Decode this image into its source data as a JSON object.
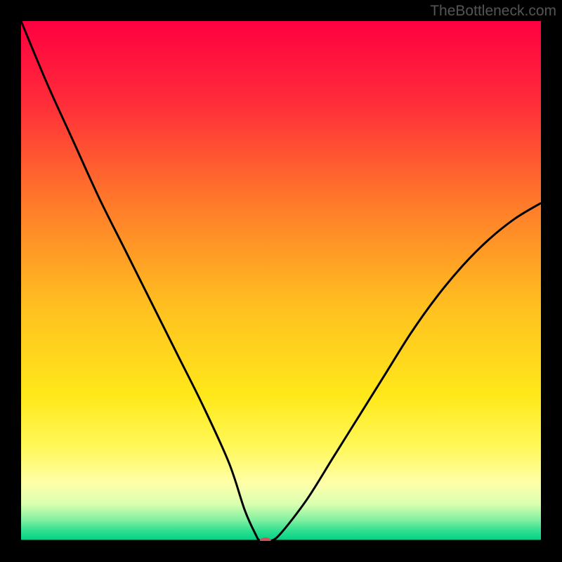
{
  "watermark": "TheBottleneck.com",
  "chart_data": {
    "type": "line",
    "title": "",
    "xlabel": "",
    "ylabel": "",
    "xlim": [
      0,
      100
    ],
    "ylim": [
      0,
      100
    ],
    "background_gradient": {
      "stops": [
        {
          "offset": 0,
          "color": "#ff0040"
        },
        {
          "offset": 15,
          "color": "#ff2a3a"
        },
        {
          "offset": 35,
          "color": "#ff7a2a"
        },
        {
          "offset": 55,
          "color": "#ffc020"
        },
        {
          "offset": 72,
          "color": "#ffe81a"
        },
        {
          "offset": 82,
          "color": "#fff85a"
        },
        {
          "offset": 89,
          "color": "#ffffaa"
        },
        {
          "offset": 93,
          "color": "#d8ffb0"
        },
        {
          "offset": 96,
          "color": "#80f0a0"
        },
        {
          "offset": 98,
          "color": "#30e090"
        },
        {
          "offset": 100,
          "color": "#00d084"
        }
      ]
    },
    "series": [
      {
        "name": "bottleneck-curve",
        "color": "#000000",
        "width": 3,
        "x": [
          0,
          5,
          10,
          15,
          20,
          25,
          30,
          35,
          40,
          43,
          45,
          46,
          48,
          50,
          55,
          60,
          65,
          70,
          75,
          80,
          85,
          90,
          95,
          100
        ],
        "y": [
          100,
          88,
          77,
          66,
          56,
          46,
          36,
          26,
          15,
          6,
          1.5,
          0,
          0,
          1.5,
          8,
          16,
          24,
          32,
          40,
          47,
          53,
          58,
          62,
          65
        ]
      }
    ],
    "marker": {
      "x": 47,
      "y": 0,
      "color": "#cc5555",
      "rx": 8,
      "ry": 5
    },
    "baseline": {
      "y": 0,
      "color": "#000000",
      "width": 3
    }
  }
}
